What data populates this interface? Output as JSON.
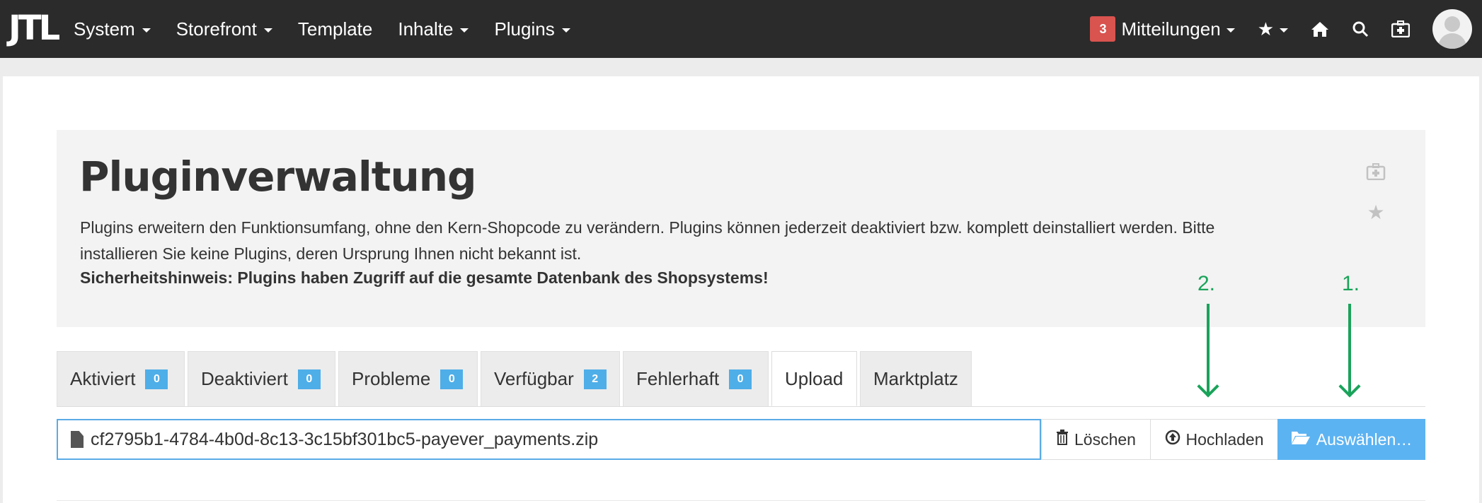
{
  "navbar": {
    "logo": "JTL",
    "menu": [
      {
        "label": "System",
        "dropdown": true
      },
      {
        "label": "Storefront",
        "dropdown": true
      },
      {
        "label": "Template",
        "dropdown": false
      },
      {
        "label": "Inhalte",
        "dropdown": true
      },
      {
        "label": "Plugins",
        "dropdown": true
      }
    ],
    "notifications_count": "3",
    "notifications_label": "Mitteilungen",
    "icons": [
      "star-icon",
      "home-icon",
      "search-icon",
      "first-aid-icon",
      "avatar"
    ]
  },
  "header": {
    "title": "Pluginverwaltung",
    "description": "Plugins erweitern den Funktionsumfang, ohne den Kern-Shopcode zu verändern. Plugins können jederzeit deaktiviert bzw. komplett deinstalliert werden. Bitte installieren Sie keine Plugins, deren Ursprung Ihnen nicht bekannt ist.",
    "warning": "Sicherheitshinweis: Plugins haben Zugriff auf die gesamte Datenbank des Shopsystems!"
  },
  "annotations": {
    "step2": "2.",
    "step1": "1."
  },
  "tabs": [
    {
      "label": "Aktiviert",
      "count": "0"
    },
    {
      "label": "Deaktiviert",
      "count": "0"
    },
    {
      "label": "Probleme",
      "count": "0"
    },
    {
      "label": "Verfügbar",
      "count": "2"
    },
    {
      "label": "Fehlerhaft",
      "count": "0"
    },
    {
      "label": "Upload",
      "active": true
    },
    {
      "label": "Marktplatz"
    }
  ],
  "upload": {
    "filename": "cf2795b1-4784-4b0d-8c13-3c15bf301bc5-payever_payments.zip",
    "delete_label": "Löschen",
    "upload_label": "Hochladen",
    "select_label": "Auswählen…"
  },
  "colors": {
    "navbar": "#2b2b2b",
    "accent": "#5cb3f2",
    "badge": "#4eaee8",
    "notification": "#d9534f",
    "annotation": "#1aa35a"
  }
}
